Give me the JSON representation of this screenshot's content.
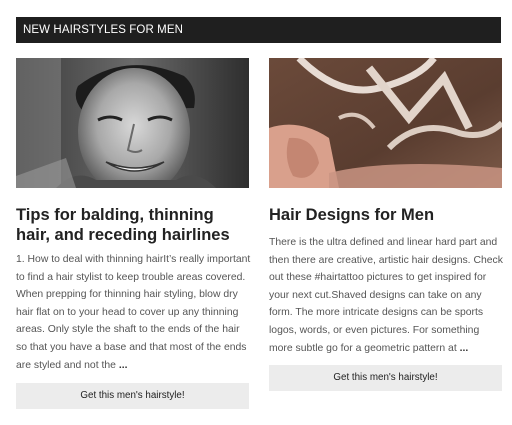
{
  "section": {
    "title": "NEW HAIRSTYLES FOR MEN"
  },
  "articles": [
    {
      "title": "Tips for balding, thinning hair, and receding hairlines",
      "excerpt": " 1. How to deal with thinning hairIt’s really important to find a hair stylist to keep trouble areas covered. When prepping for thinning hair styling, blow dry hair flat on to your head to cover up any thinning areas. Only style the shaft to the ends of the hair so that you have a base and that most of the ends are styled and not the ",
      "ellipsis": "...",
      "button_label": "Get this men's hairstyle!",
      "image": "black-and-white-portrait-smiling-man"
    },
    {
      "title": "Hair Designs for Men",
      "excerpt": " There is the ultra defined and linear hard part and then there are creative, artistic hair designs. Check out these #hairtattoo pictures to get inspired for your next cut.Shaved designs can take on any form. The more intricate designs can be sports logos, words, or even pictures. For something more subtle go for a geometric pattern at ",
      "ellipsis": "...",
      "button_label": "Get this men's hairstyle!",
      "image": "shaved-hair-design-back-of-head"
    }
  ]
}
